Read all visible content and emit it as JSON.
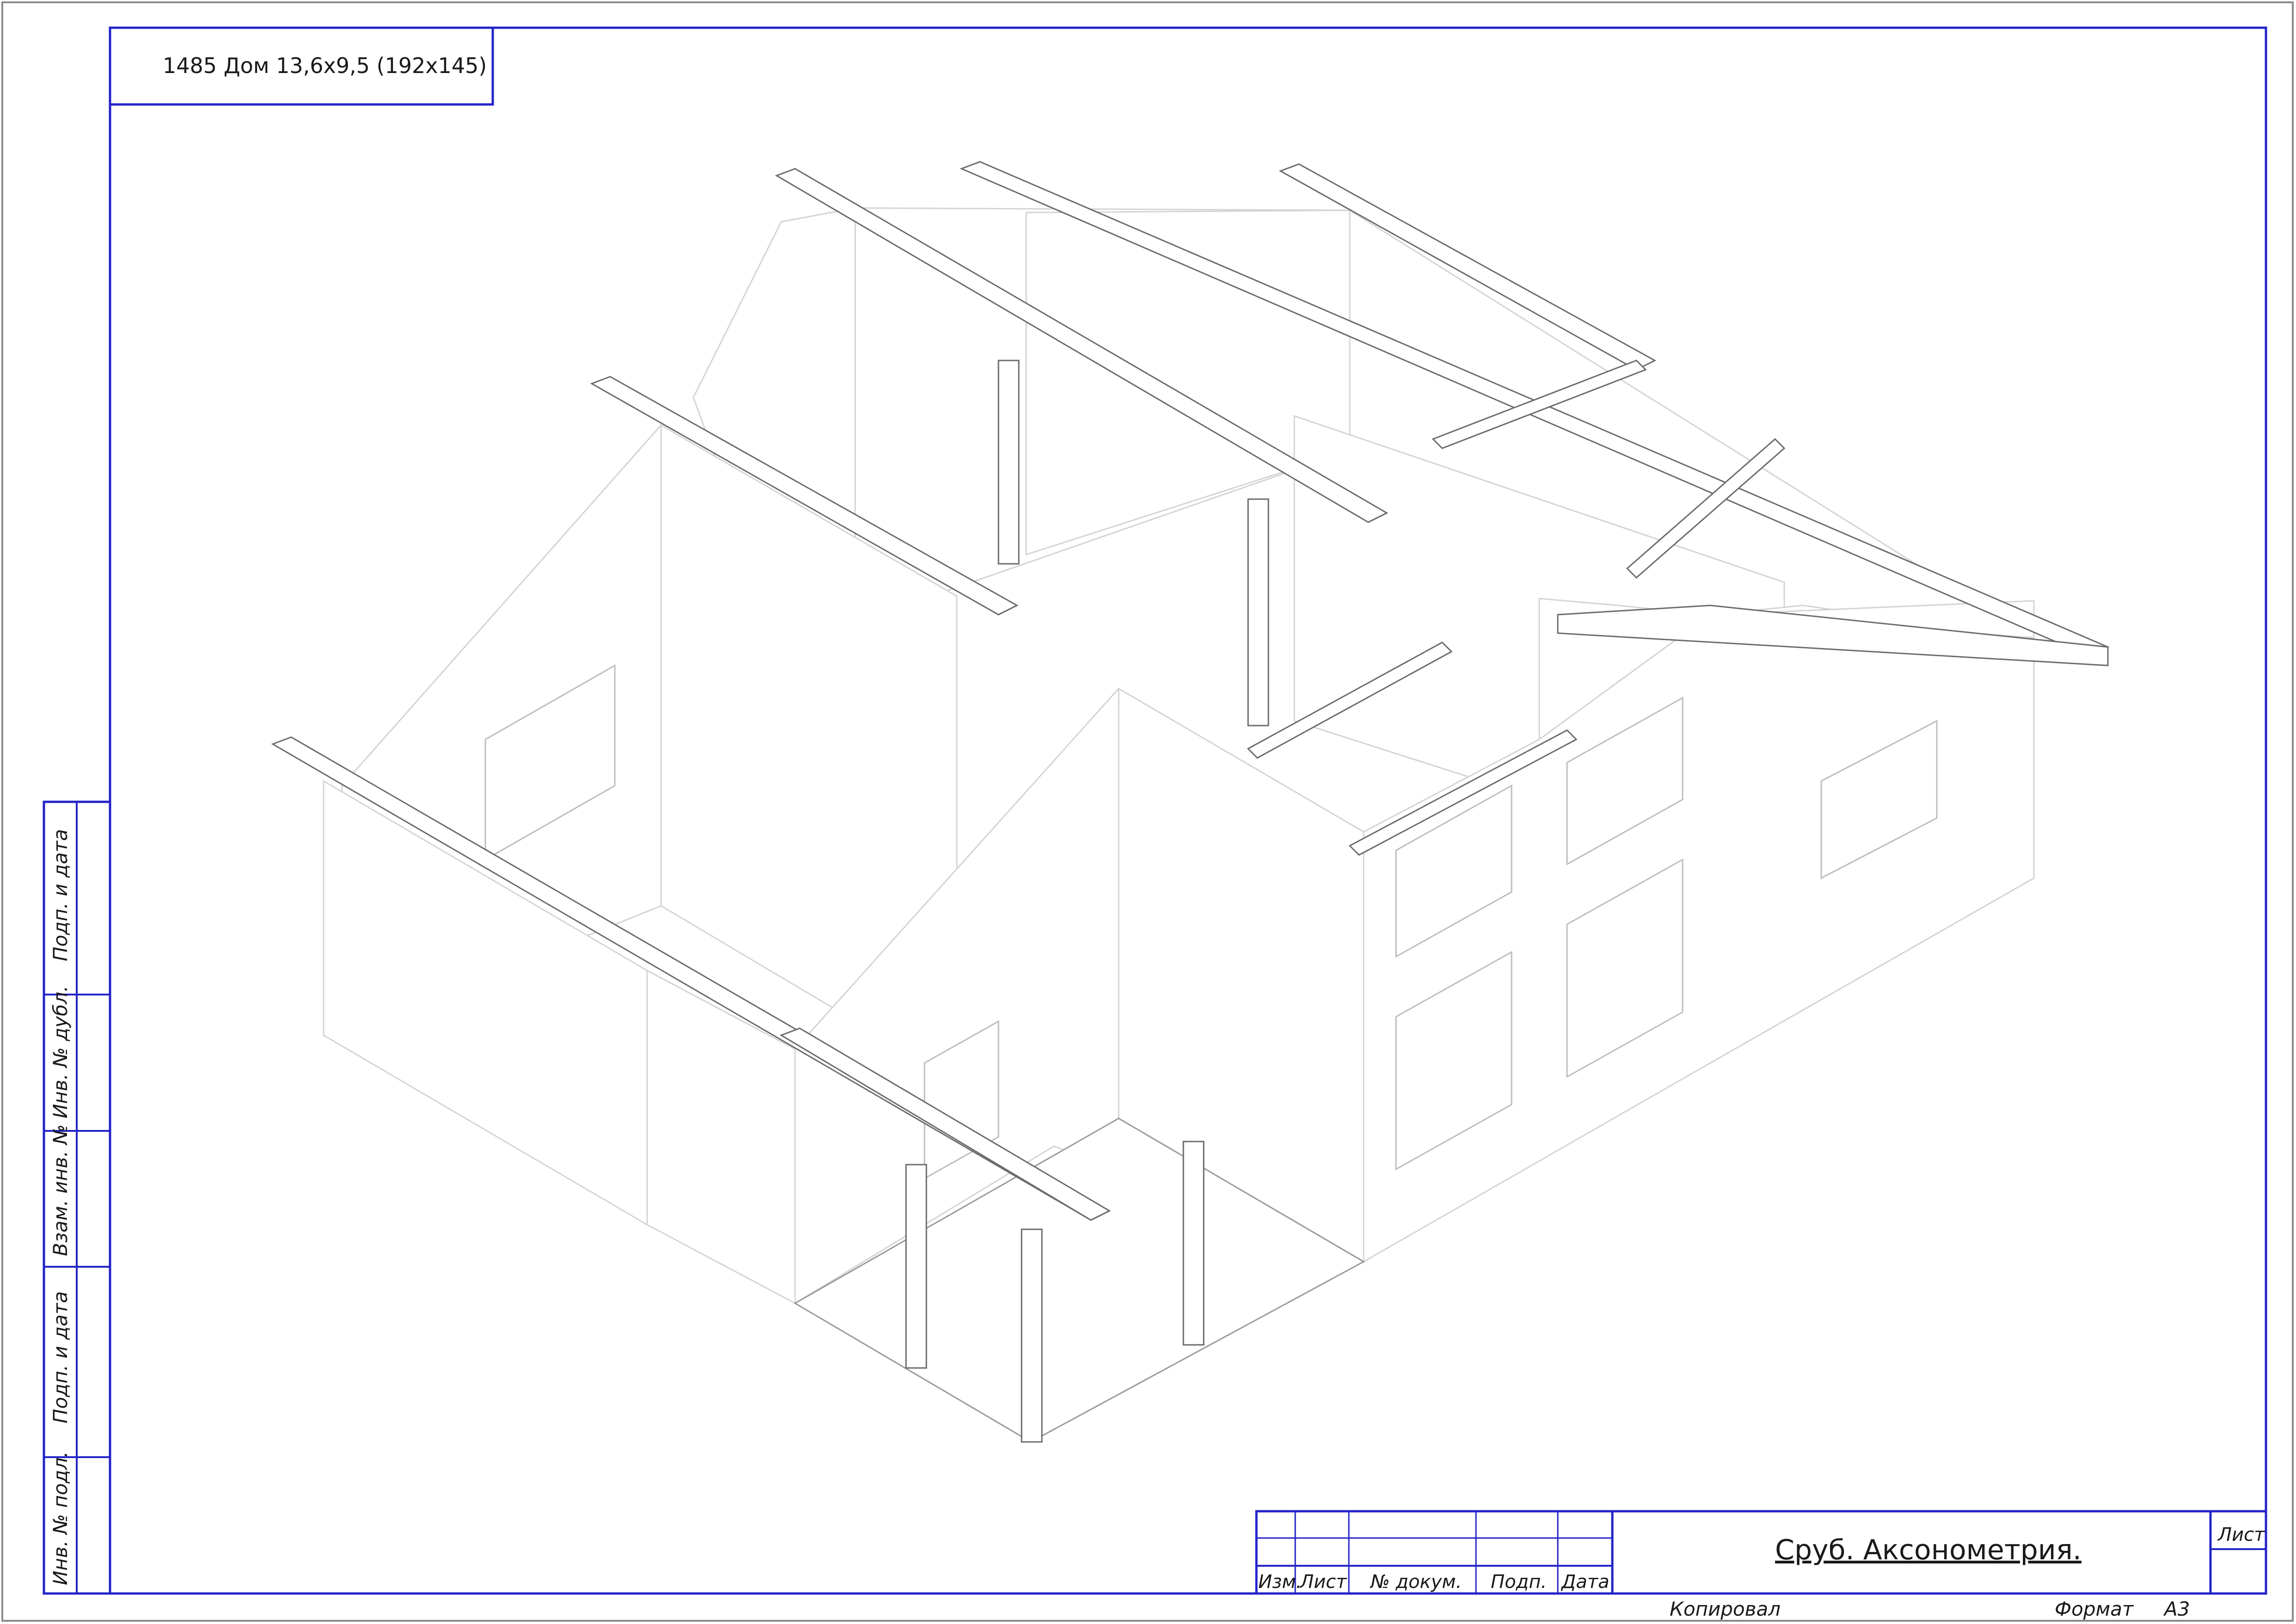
{
  "drawing_title": "1485 Дом 13,6х9,5 (192х145)",
  "sheet_name": "Сруб. Аксонометрия.",
  "stamp": {
    "izm": "Изм.",
    "list": "Лист",
    "doc_no": "№ докум.",
    "sign": "Подп.",
    "date": "Дата",
    "sheet_label": "Лист"
  },
  "footer": {
    "copied": "Копировал",
    "format_label": "Формат",
    "format_value": "А3"
  },
  "side_stamp": {
    "podp_i_data_top": "Подп. и дата",
    "inv_dubl": "Инв. № дубл.",
    "vzam_inv": "Взам. инв. №",
    "podp_i_data_bottom": "Подп. и дата",
    "inv_podl": "Инв. № подл."
  },
  "colors": {
    "frame": "#2323c8",
    "log_lines": "#8c1a1a",
    "outline": "#d4d4d4"
  }
}
